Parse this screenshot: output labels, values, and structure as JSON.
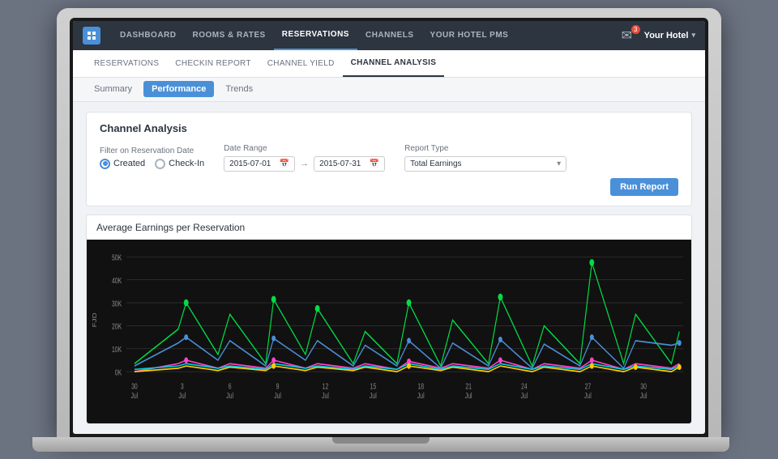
{
  "nav": {
    "logo_icon": "home-icon",
    "links": [
      {
        "label": "Dashboard",
        "active": false
      },
      {
        "label": "Rooms & Rates",
        "active": false
      },
      {
        "label": "Reservations",
        "active": true
      },
      {
        "label": "Channels",
        "active": false
      },
      {
        "label": "Your Hotel PMS",
        "active": false
      }
    ],
    "notification_count": "3",
    "hotel_name": "Your Hotel",
    "chevron": "▾"
  },
  "sub_nav": {
    "links": [
      {
        "label": "Reservations",
        "active": false
      },
      {
        "label": "Checkin Report",
        "active": false
      },
      {
        "label": "Channel Yield",
        "active": false
      },
      {
        "label": "Channel Analysis",
        "active": true
      }
    ]
  },
  "tabs": {
    "items": [
      {
        "label": "Summary",
        "active": false
      },
      {
        "label": "Performance",
        "active": true
      },
      {
        "label": "Trends",
        "active": false
      }
    ]
  },
  "form": {
    "title": "Channel Analysis",
    "filter_label": "Filter on Reservation Date",
    "radio_created": "Created",
    "radio_checkin": "Check-In",
    "date_range_label": "Date Range",
    "date_start": "2015-07-01",
    "date_end": "2015-07-31",
    "report_type_label": "Report Type",
    "report_type_value": "Total Earnings",
    "run_button": "Run Report"
  },
  "chart": {
    "title": "Average Earnings per Reservation",
    "y_axis_label": "FJD",
    "y_labels": [
      "50K",
      "40K",
      "30K",
      "20K",
      "10K",
      "0K"
    ],
    "x_labels": [
      "30 Jul",
      "3 Jul",
      "6 Jul",
      "9 Jul",
      "12 Jul",
      "15 Jul",
      "18 Jul",
      "21 Jul",
      "24 Jul",
      "27 Jul",
      "30 Jul"
    ]
  }
}
